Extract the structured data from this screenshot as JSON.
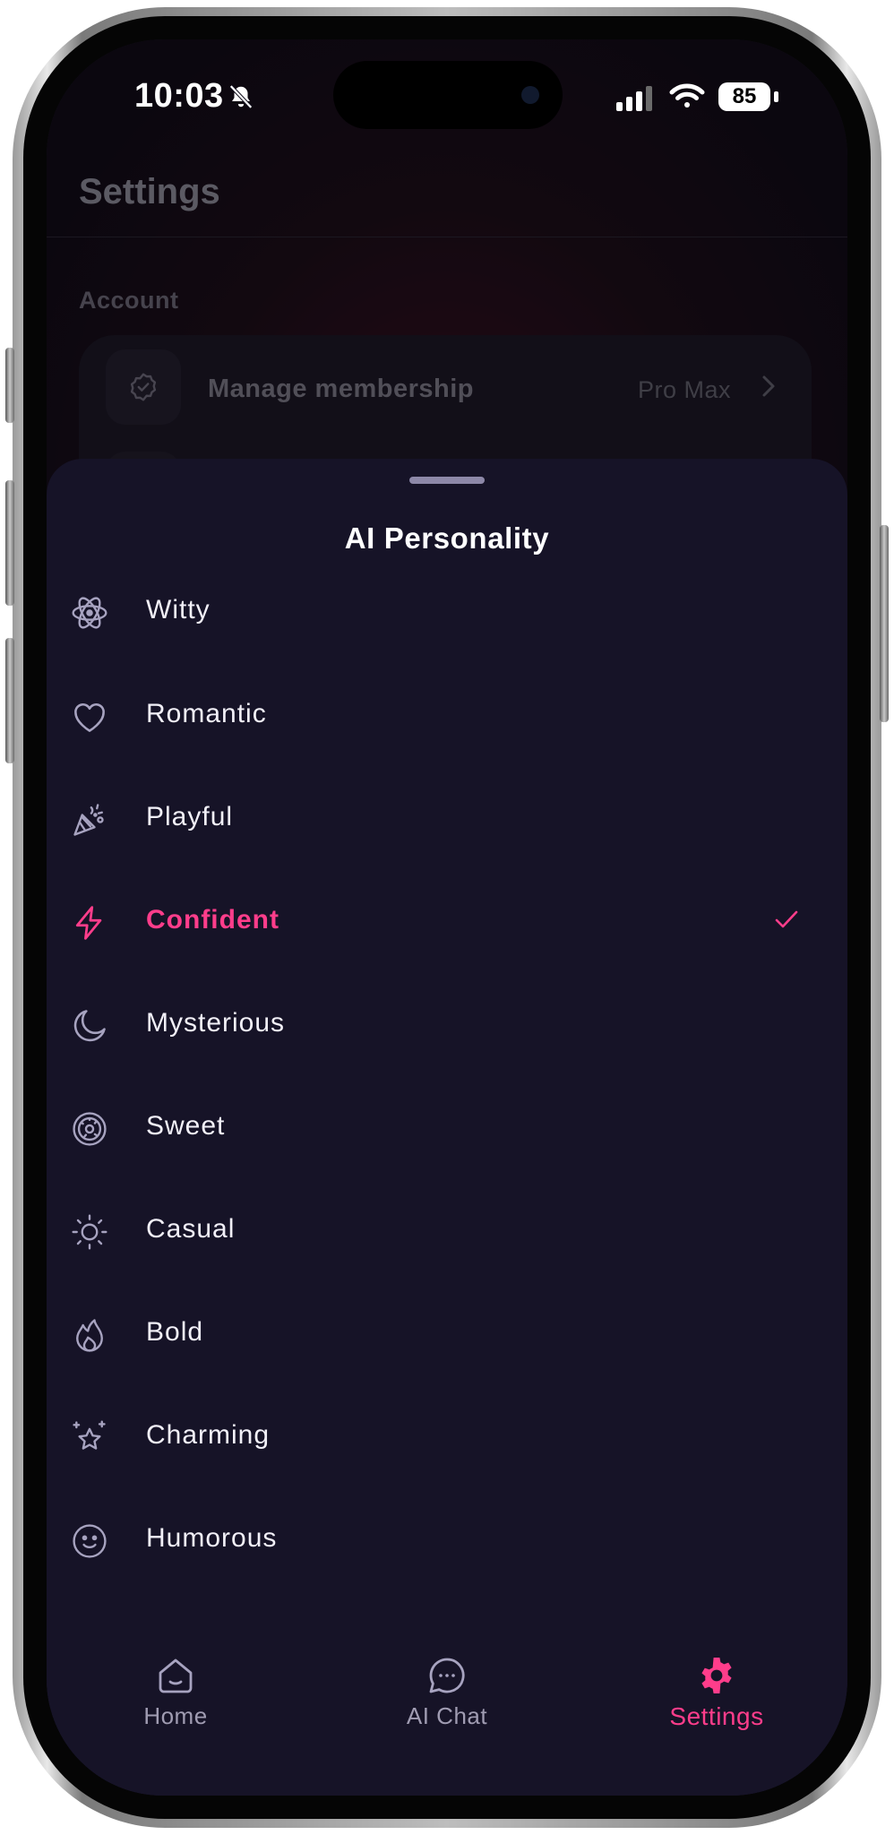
{
  "status_bar": {
    "time": "10:03",
    "battery": "85"
  },
  "background_page": {
    "title": "Settings",
    "section_label": "Account",
    "membership": {
      "label": "Manage membership",
      "value": "Pro Max"
    }
  },
  "sheet": {
    "title": "AI Personality",
    "options": [
      {
        "label": "Witty",
        "icon": "atom-icon",
        "selected": false
      },
      {
        "label": "Romantic",
        "icon": "heart-icon",
        "selected": false
      },
      {
        "label": "Playful",
        "icon": "party-popper-icon",
        "selected": false
      },
      {
        "label": "Confident",
        "icon": "lightning-icon",
        "selected": true
      },
      {
        "label": "Mysterious",
        "icon": "moon-icon",
        "selected": false
      },
      {
        "label": "Sweet",
        "icon": "donut-icon",
        "selected": false
      },
      {
        "label": "Casual",
        "icon": "sun-icon",
        "selected": false
      },
      {
        "label": "Bold",
        "icon": "flame-icon",
        "selected": false
      },
      {
        "label": "Charming",
        "icon": "sparkle-star-icon",
        "selected": false
      },
      {
        "label": "Humorous",
        "icon": "smile-icon",
        "selected": false
      }
    ]
  },
  "tab_bar": {
    "tabs": [
      {
        "label": "Home",
        "icon": "home-icon",
        "active": false
      },
      {
        "label": "AI Chat",
        "icon": "chat-bubble-icon",
        "active": false
      },
      {
        "label": "Settings",
        "icon": "gear-icon",
        "active": true
      }
    ]
  },
  "colors": {
    "accent": "#ff3d8b",
    "sheet_background": "#161327",
    "text": "#f2f0f8",
    "icon_muted": "#a7a3c0"
  }
}
